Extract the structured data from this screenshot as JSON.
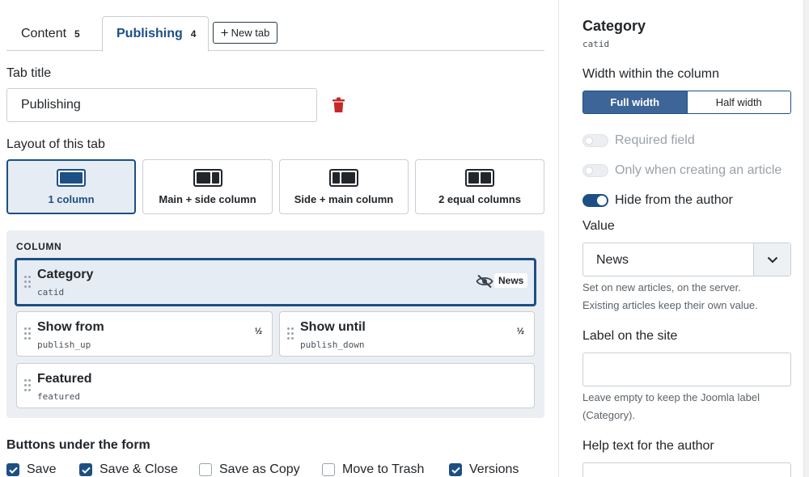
{
  "tabs": [
    {
      "label": "Content",
      "count": "5"
    },
    {
      "label": "Publishing",
      "count": "4"
    }
  ],
  "new_tab_label": "New tab",
  "tab_title": {
    "label": "Tab title",
    "value": "Publishing"
  },
  "layout": {
    "label": "Layout of this tab",
    "options": [
      {
        "label": "1 column",
        "selected": true
      },
      {
        "label": "Main + side column",
        "selected": false
      },
      {
        "label": "Side + main column",
        "selected": false
      },
      {
        "label": "2 equal columns",
        "selected": false
      }
    ]
  },
  "column": {
    "heading": "COLUMN",
    "fields": [
      {
        "title": "Category",
        "code": "catid",
        "value_badge": "News",
        "hidden": true
      },
      {
        "title": "Show from",
        "code": "publish_up",
        "width_badge": "½"
      },
      {
        "title": "Show until",
        "code": "publish_down",
        "width_badge": "½"
      },
      {
        "title": "Featured",
        "code": "featured"
      }
    ]
  },
  "form_buttons": {
    "heading": "Buttons under the form",
    "items": [
      {
        "label": "Save",
        "checked": true
      },
      {
        "label": "Save & Close",
        "checked": true
      },
      {
        "label": "Save as Copy",
        "checked": false
      },
      {
        "label": "Move to Trash",
        "checked": false
      },
      {
        "label": "Versions",
        "checked": true
      }
    ]
  },
  "sidebar": {
    "title": "Category",
    "code": "catid",
    "width_label": "Width within the column",
    "width_options": [
      {
        "label": "Full width",
        "active": true
      },
      {
        "label": "Half width",
        "active": false
      }
    ],
    "toggles": [
      {
        "label": "Required field",
        "on": false,
        "disabled": true
      },
      {
        "label": "Only when creating an article",
        "on": false,
        "disabled": true
      },
      {
        "label": "Hide from the author",
        "on": true,
        "disabled": false
      }
    ],
    "value_label": "Value",
    "value_selected": "News",
    "value_help_1": "Set on new articles, on the server.",
    "value_help_2": "Existing articles keep their own value.",
    "site_label": "Label on the site",
    "site_value": "",
    "site_help_1": "Leave empty to keep the Joomla label",
    "site_help_2": "(Category).",
    "help_text_label": "Help text for the author"
  },
  "colors": {
    "primary": "#1d4f84",
    "danger": "#c62828",
    "panel": "#ebeef2"
  }
}
